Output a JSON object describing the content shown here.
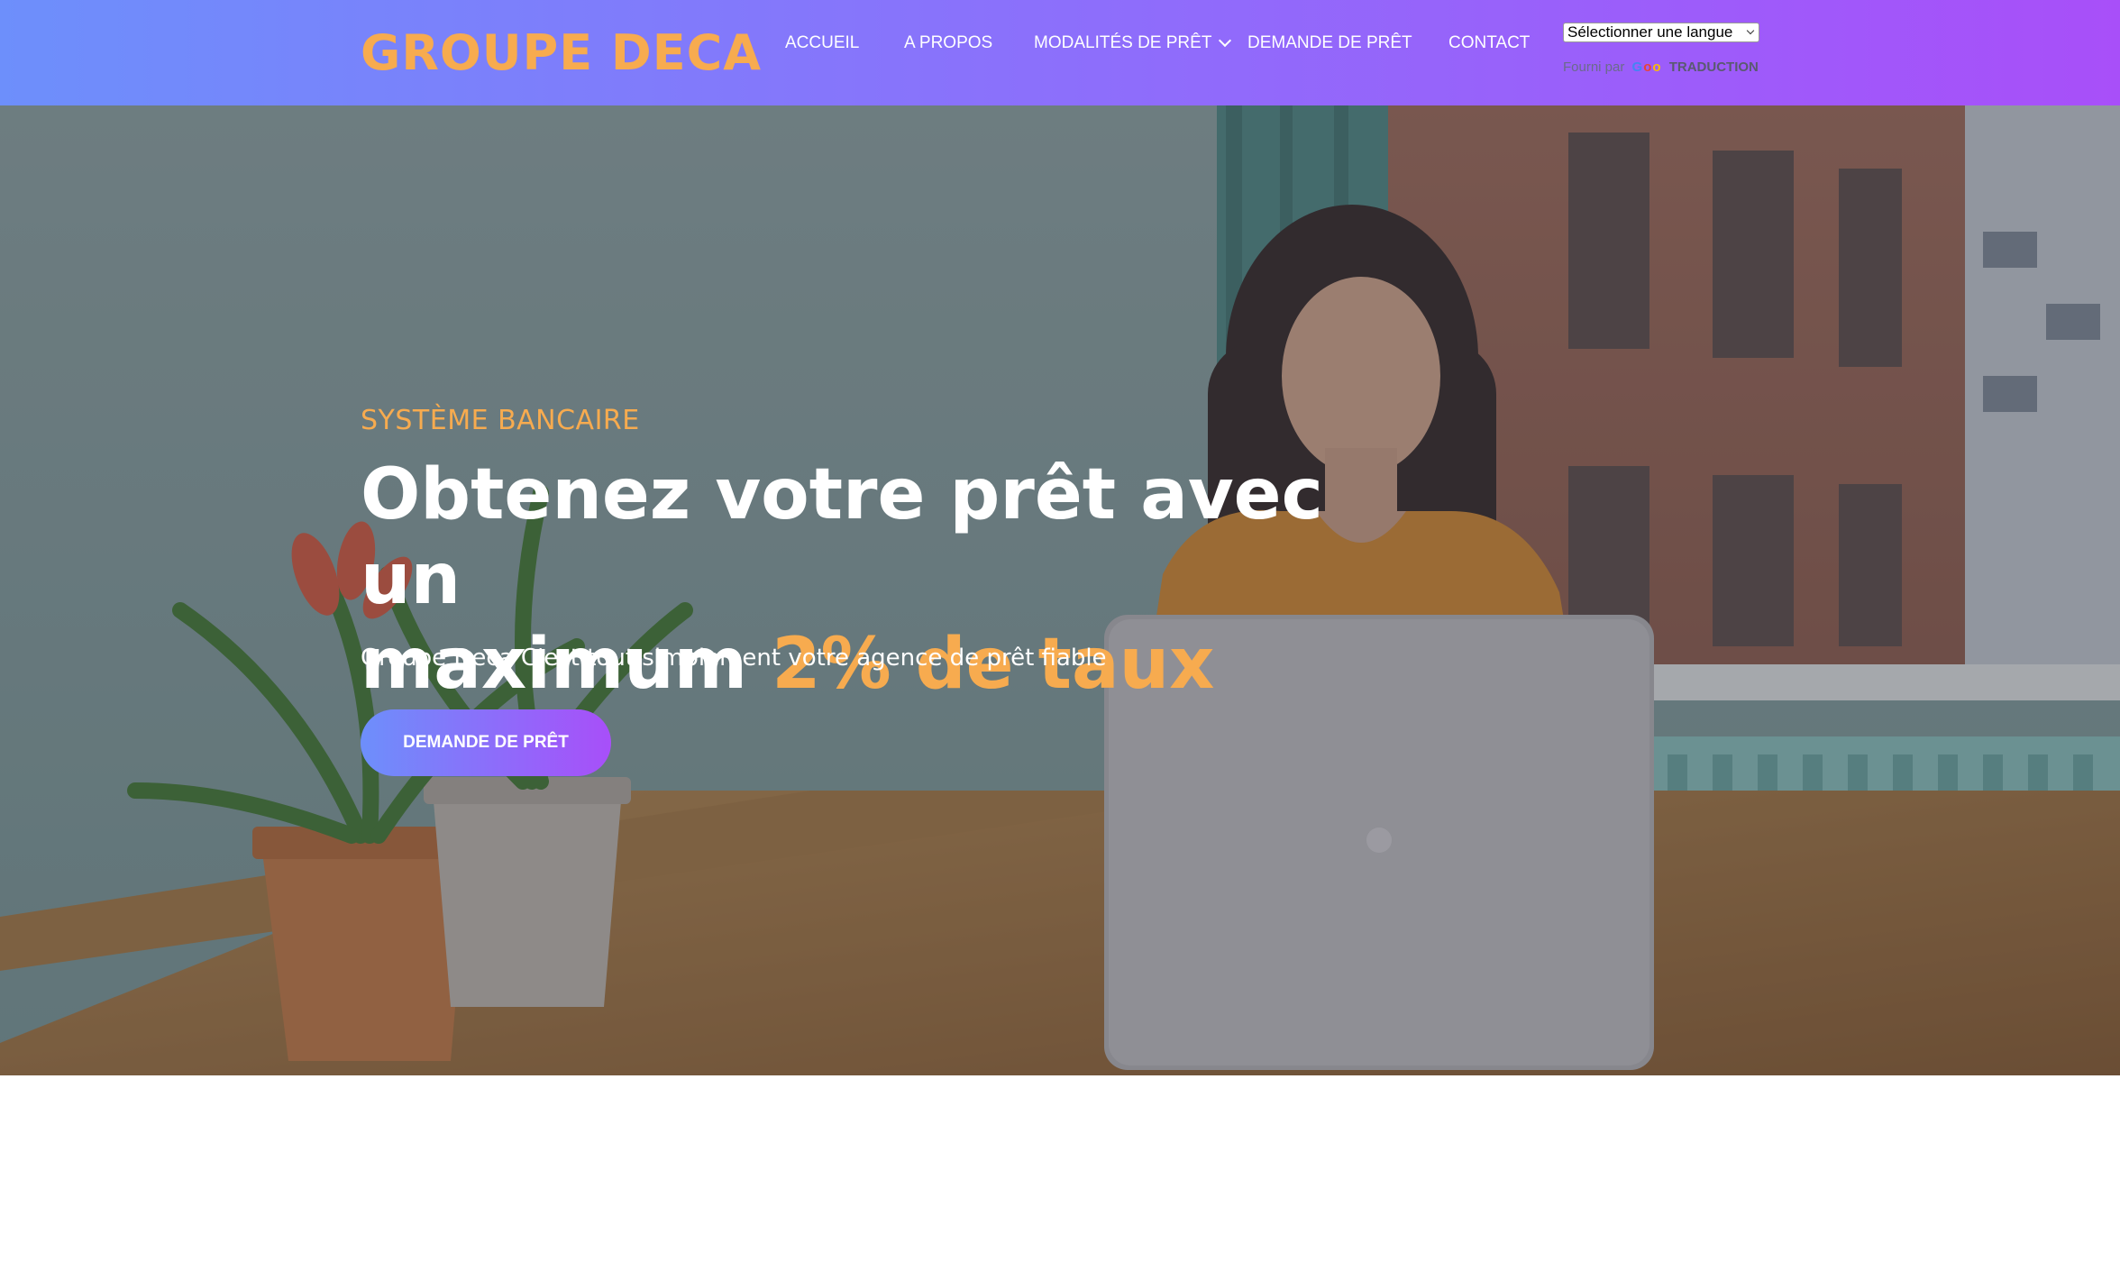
{
  "header": {
    "logo": "GROUPE DECA",
    "nav": [
      {
        "label": "ACCUEIL"
      },
      {
        "label": "A PROPOS"
      },
      {
        "label": "MODALITÉS DE PRÊT",
        "has_dropdown": true
      },
      {
        "label": "DEMANDE DE PRÊT"
      },
      {
        "label": "CONTACT"
      }
    ],
    "translate": {
      "select_value": "Sélectionner une langue",
      "powered_by": "Fourni par",
      "powered_brand": "TRADUCTION"
    }
  },
  "hero": {
    "eyebrow": "SYSTÈME BANCAIRE",
    "headline_line1": "Obtenez votre prêt avec un",
    "headline_line2_start": "maximum",
    "headline_line2_accent": "2% de taux",
    "subtitle": "Groupe Deca C'est tout simplement votre agence de prêt fiable",
    "cta_label": "DEMANDE DE PRÊT"
  },
  "colors": {
    "nav_gradient_start": "#6d8ffb",
    "nav_gradient_end": "#a84ff9",
    "accent_orange": "#f7ab4f",
    "text_white": "#ffffff"
  },
  "icons": {
    "dropdown": "chevron-down-icon",
    "select_arrow": "select-arrow-icon"
  }
}
